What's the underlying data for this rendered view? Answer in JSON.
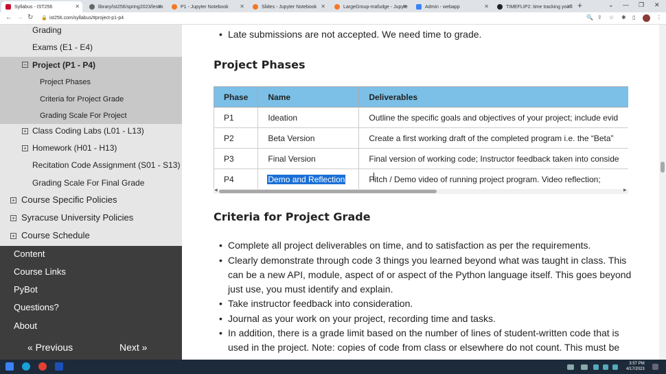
{
  "browser": {
    "tabs": [
      {
        "label": "Syllabus - IST256",
        "color": "#c8102e"
      },
      {
        "label": "library/ist256/spring2023/lesso",
        "color": "#444444"
      },
      {
        "label": "P1 - Jupyter Notebook",
        "color": "#f37726"
      },
      {
        "label": "Slides - Jupyter Notebook",
        "color": "#f37726"
      },
      {
        "label": "LargeGroup-mafudge - Jupyte",
        "color": "#f37726"
      },
      {
        "label": "Admin - webapp",
        "color": "#3b82f6"
      },
      {
        "label": "TIMEFLIP2: time tracking you'll",
        "color": "#222222"
      }
    ],
    "url": "ist256.com/syllabus/#project-p1-p4"
  },
  "sidebar": {
    "items": [
      {
        "label": "Grading",
        "toggle": ""
      },
      {
        "label": "Exams (E1 - E4)",
        "toggle": ""
      },
      {
        "label": "Project (P1 - P4)",
        "toggle": "−"
      },
      {
        "label": "Project Phases",
        "toggle": ""
      },
      {
        "label": "Criteria for Project Grade",
        "toggle": ""
      },
      {
        "label": "Grading Scale For Project",
        "toggle": ""
      },
      {
        "label": "Class Coding Labs (L01 - L13)",
        "toggle": "+"
      },
      {
        "label": "Homework (H01 - H13)",
        "toggle": "+"
      },
      {
        "label": "Recitation Code Assignment (S01 - S13)",
        "toggle": ""
      },
      {
        "label": "Grading Scale For Final Grade",
        "toggle": ""
      },
      {
        "label": "Course Specific Policies",
        "toggle": "+"
      },
      {
        "label": "Syracuse University Policies",
        "toggle": "+"
      },
      {
        "label": "Course Schedule",
        "toggle": "+"
      }
    ],
    "links": [
      "Content",
      "Course Links",
      "PyBot",
      "Questions?",
      "About"
    ],
    "prev": "« Previous",
    "next": "Next »"
  },
  "content": {
    "late_bullet": "Late submissions are not accepted. We need time to grade.",
    "phases_heading": "Project Phases",
    "table": {
      "headers": [
        "Phase",
        "Name",
        "Deliverables"
      ],
      "rows": [
        [
          "P1",
          "Ideation",
          "Outline the specific goals and objectives of your project; include evid"
        ],
        [
          "P2",
          "Beta Version",
          "Create a first working draft of the completed program i.e. the “Beta”"
        ],
        [
          "P3",
          "Final Version",
          "Final version of working code; Instructor feedback taken into conside"
        ],
        [
          "P4",
          "Demo and Reflection",
          "Pitch / Demo video of running project program. Video reflection;"
        ]
      ]
    },
    "criteria_heading": "Criteria for Project Grade",
    "criteria_bullets": [
      "Complete all project deliverables on time, and to satisfaction as per the requirements.",
      "Clearly demonstrate through code 3 things you learned beyond what was taught in class. This",
      "Take instructor feedback into consideration.",
      "Journal as your work on your project, recording time and tasks.",
      "In addition, there is a grade limit based on the number of lines of student-written code that is"
    ],
    "criteria_continuations": [
      "can be a new API, module, aspect of or aspect of the Python language itself. This goes beyond",
      "just use, you must identify and explain.",
      "used in the project. Note: copies of code from class or elsewhere do not count. This must be"
    ]
  },
  "taskbar": {
    "time": "3:57 PM",
    "date": "4/17/2023"
  }
}
